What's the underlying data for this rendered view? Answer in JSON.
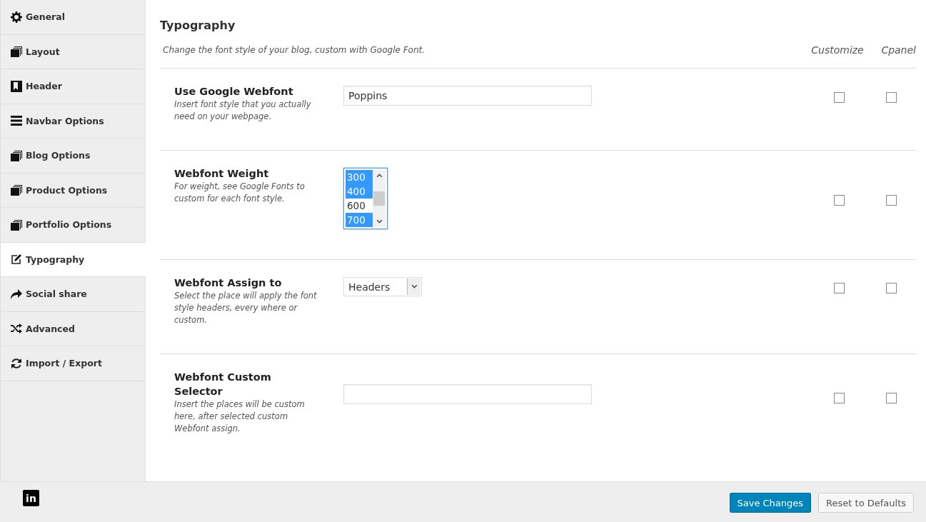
{
  "sidebar": {
    "items": [
      {
        "label": "General",
        "selected": false
      },
      {
        "label": "Layout",
        "selected": false
      },
      {
        "label": "Header",
        "selected": false
      },
      {
        "label": "Navbar Options",
        "selected": false
      },
      {
        "label": "Blog Options",
        "selected": false
      },
      {
        "label": "Product Options",
        "selected": false
      },
      {
        "label": "Portfolio Options",
        "selected": false
      },
      {
        "label": "Typography",
        "selected": true
      },
      {
        "label": "Social share",
        "selected": false
      },
      {
        "label": "Advanced",
        "selected": false
      },
      {
        "label": "Import / Export",
        "selected": false
      }
    ]
  },
  "section": {
    "title": "Typography",
    "description": "Change the font style of your blog, custom with Google Font.",
    "columns": [
      "Customize",
      "Cpanel"
    ]
  },
  "options": [
    {
      "kind": "text",
      "label": "Use Google Webfont",
      "hint": "Insert font style that you actually need on your webpage.",
      "value": "Poppins",
      "customize": false,
      "cpanel": false
    },
    {
      "kind": "multiselect",
      "label": "Webfont Weight",
      "hint": "For weight, see Google Fonts to custom for each font style.",
      "choices": [
        {
          "label": "300",
          "selected": true
        },
        {
          "label": "400",
          "selected": true
        },
        {
          "label": "600",
          "selected": false
        },
        {
          "label": "700",
          "selected": true
        }
      ],
      "customize": false,
      "cpanel": false
    },
    {
      "kind": "dropdown",
      "label": "Webfont Assign to",
      "hint": "Select the place will apply the font style headers, every where or custom.",
      "value": "Headers",
      "customize": false,
      "cpanel": false
    },
    {
      "kind": "text",
      "label": "Webfont Custom Selector",
      "hint": "Insert the places will be custom here, after selected custom Webfont assign.",
      "customize": false,
      "cpanel": false
    }
  ],
  "footer": {
    "logo_text": "in",
    "buttons": [
      {
        "label": "Save Changes",
        "kind": "primary"
      },
      {
        "label": "Reset to Defaults",
        "kind": "secondary"
      }
    ]
  }
}
